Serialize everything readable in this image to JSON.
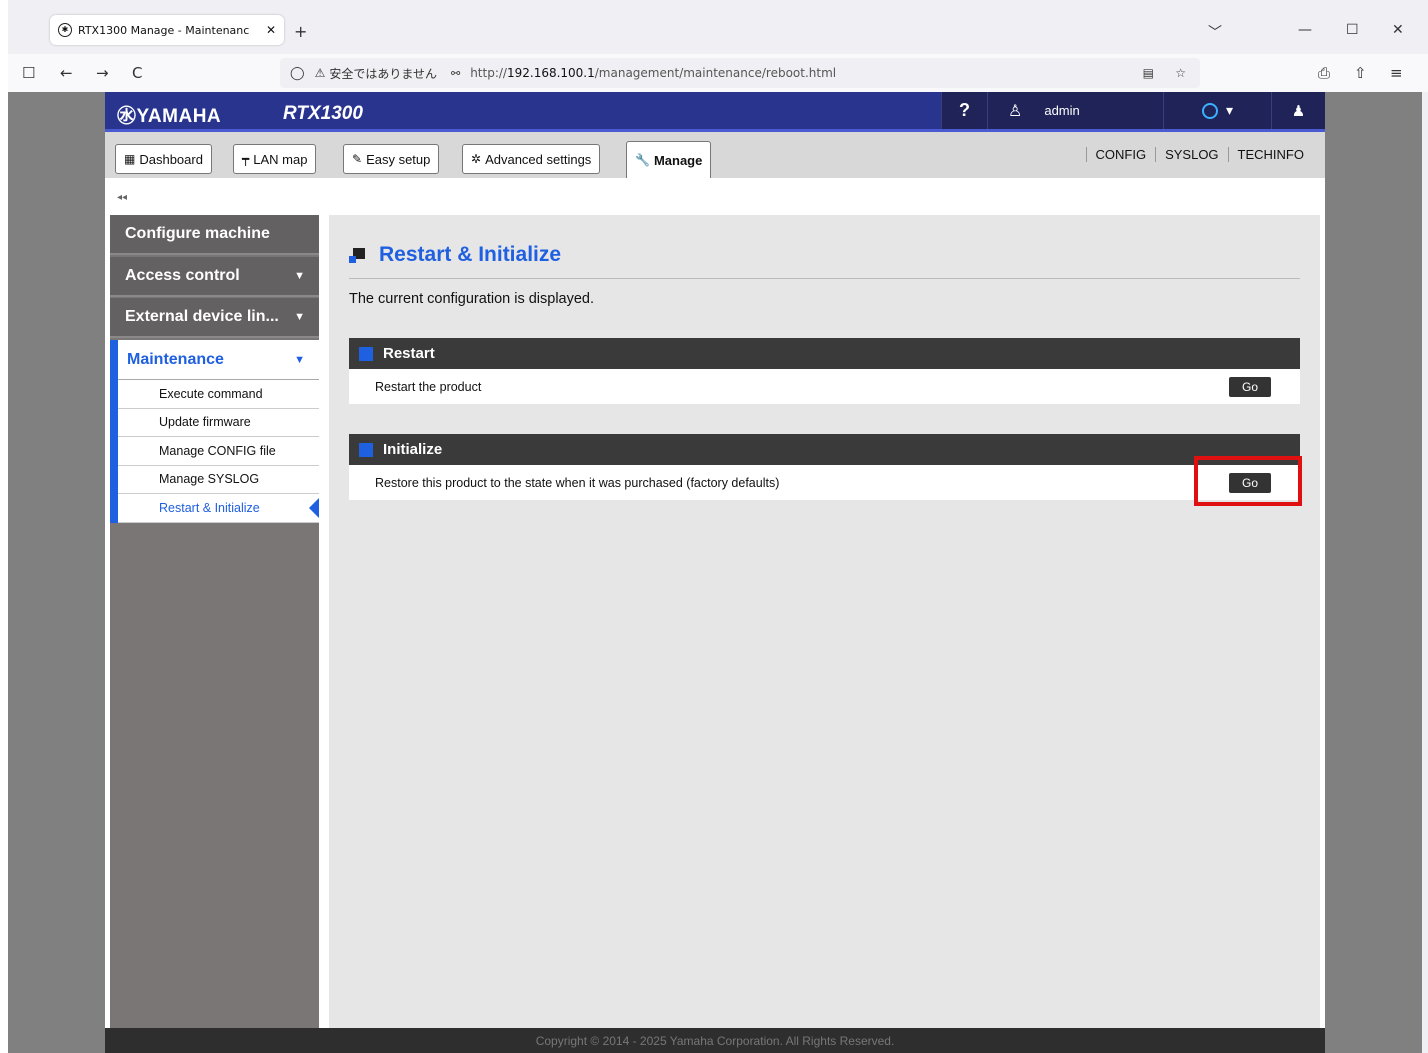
{
  "browser": {
    "tab_title": "RTX1300 Manage - Maintenanc",
    "tab_close": "✕",
    "new_tab": "+",
    "win_dropdown": "﹀",
    "win_minimize": "—",
    "win_maximize": "☐",
    "win_close": "✕",
    "nav": {
      "sidebar": "☐",
      "back": "←",
      "forward": "→",
      "reload": "C"
    },
    "insecure_label": "安全ではありません",
    "url_prefix": "http://",
    "url_host": "192.168.100.1",
    "url_path": "/management/maintenance/reboot.html",
    "extra": {
      "ext": "⎙",
      "share": "⇧",
      "menu": "≡"
    }
  },
  "header": {
    "logo": "㊌YAMAHA",
    "model": "RTX1300",
    "help": "?",
    "user": "admin",
    "status_arrow": "▾",
    "bell": "🔔"
  },
  "toolbar": {
    "dashboard": "Dashboard",
    "lanmap": "LAN map",
    "easy_setup": "Easy setup",
    "advanced": "Advanced settings",
    "manage": "Manage",
    "links": [
      "CONFIG",
      "SYSLOG",
      "TECHINFO"
    ]
  },
  "collapse_label": "◂◂",
  "sidebar": {
    "configure": "Configure machine",
    "access": "Access control",
    "external": "External device lin...",
    "maintenance": "Maintenance",
    "sub": [
      "Execute command",
      "Update firmware",
      "Manage CONFIG file",
      "Manage SYSLOG",
      "Restart & Initialize"
    ],
    "arrow": "▼"
  },
  "main": {
    "title": "Restart & Initialize",
    "description": "The current configuration is displayed.",
    "restart_head": "Restart",
    "restart_row": "Restart the product",
    "initialize_head": "Initialize",
    "initialize_row": "Restore this product to the state when it was purchased (factory defaults)",
    "go": "Go"
  },
  "footer": "Copyright © 2014 - 2025 Yamaha Corporation. All Rights Reserved.",
  "colors": {
    "brand": "#29348f",
    "accent": "#1f60e0",
    "highlight": "#e01010"
  },
  "icons": [
    "yamaha-logo-icon",
    "help-icon",
    "user-icon",
    "status-ring-icon",
    "bell-icon",
    "dashboard-icon",
    "lanmap-icon",
    "easy-setup-icon",
    "gear-icon",
    "wrench-icon"
  ]
}
